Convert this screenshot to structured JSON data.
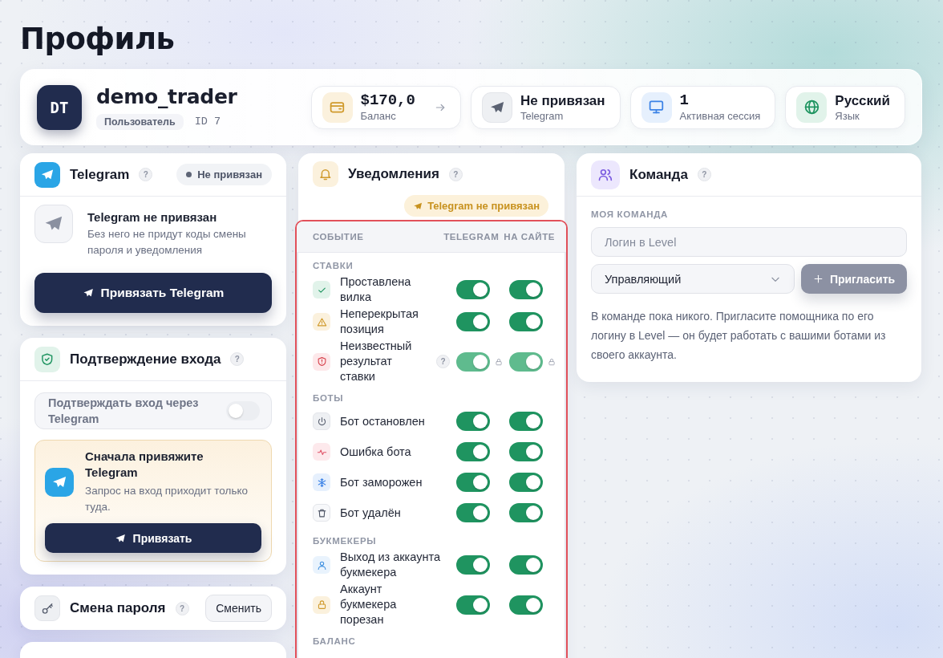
{
  "page": {
    "title": "Профиль"
  },
  "profile": {
    "initials": "DT",
    "username": "demo_trader",
    "role": "Пользователь",
    "id_label": "ID 7"
  },
  "stats": [
    {
      "kind": "balance",
      "value": "$170,0",
      "label": "Баланс",
      "arrow": true
    },
    {
      "kind": "telegram",
      "value": "Не привязан",
      "label": "Telegram",
      "arrow": false
    },
    {
      "kind": "sessions",
      "value": "1",
      "label": "Активная сессия",
      "arrow": false
    },
    {
      "kind": "language",
      "value": "Русский",
      "label": "Язык",
      "arrow": false
    }
  ],
  "telegram_card": {
    "title": "Telegram",
    "help": "?",
    "status": "Не привязан",
    "linked": false,
    "notice_title": "Telegram не привязан",
    "notice_text": "Без него не придут коды смены пароля и уведомления",
    "button": "Привязать Telegram"
  },
  "login_confirm_card": {
    "title": "Подтверждение входа",
    "help": "?",
    "toggle": {
      "label": "Подтверждать вход через Telegram",
      "on": false,
      "disabled": true
    },
    "warning": {
      "title": "Сначала привяжите Telegram",
      "text": "Запрос на вход приходит только туда.",
      "button": "Привязать"
    }
  },
  "password_card": {
    "title": "Смена пароля",
    "help": "?",
    "button": "Сменить"
  },
  "notifications": {
    "title": "Уведомления",
    "help": "?",
    "badge": "Telegram не привязан",
    "highlighted": true,
    "columns": [
      "СОБЫТИЕ",
      "TELEGRAM",
      "НА САЙТЕ"
    ],
    "groups": [
      {
        "label": "СТАВКИ",
        "rows": [
          {
            "kind": "success",
            "label": "Проставлена вилка",
            "telegram": true,
            "site": true,
            "locked": false
          },
          {
            "kind": "warning",
            "label": "Неперекрытая позиция",
            "telegram": true,
            "site": true,
            "locked": false
          },
          {
            "kind": "danger",
            "label": "Неизвестный результат ставки",
            "help": "?",
            "telegram": true,
            "site": true,
            "locked": true
          }
        ]
      },
      {
        "label": "БОТЫ",
        "rows": [
          {
            "kind": "stopped",
            "label": "Бот остановлен",
            "telegram": true,
            "site": true,
            "locked": false
          },
          {
            "kind": "error",
            "label": "Ошибка бота",
            "telegram": true,
            "site": true,
            "locked": false
          },
          {
            "kind": "frozen",
            "label": "Бот заморожен",
            "telegram": true,
            "site": true,
            "locked": false
          },
          {
            "kind": "deleted",
            "label": "Бот удалён",
            "telegram": true,
            "site": true,
            "locked": false
          }
        ]
      },
      {
        "label": "БУКМЕКЕРЫ",
        "rows": [
          {
            "kind": "logout",
            "label": "Выход из аккаунта букмекера",
            "telegram": true,
            "site": true,
            "locked": false
          },
          {
            "kind": "banned",
            "label": "Аккаунт букмекера порезан",
            "telegram": true,
            "site": true,
            "locked": false
          }
        ]
      },
      {
        "label": "БАЛАНС"
      }
    ]
  },
  "team": {
    "title": "Команда",
    "help": "?",
    "section": "МОЯ КОМАНДА",
    "login_placeholder": "Логин в Level",
    "role_value": "Управляющий",
    "invite_button": "Пригласить",
    "invite_disabled": true,
    "empty_text": "В команде пока никого. Пригласите помощника по его логину в Level — он будет работать с вашими ботами из своего аккаунта."
  }
}
